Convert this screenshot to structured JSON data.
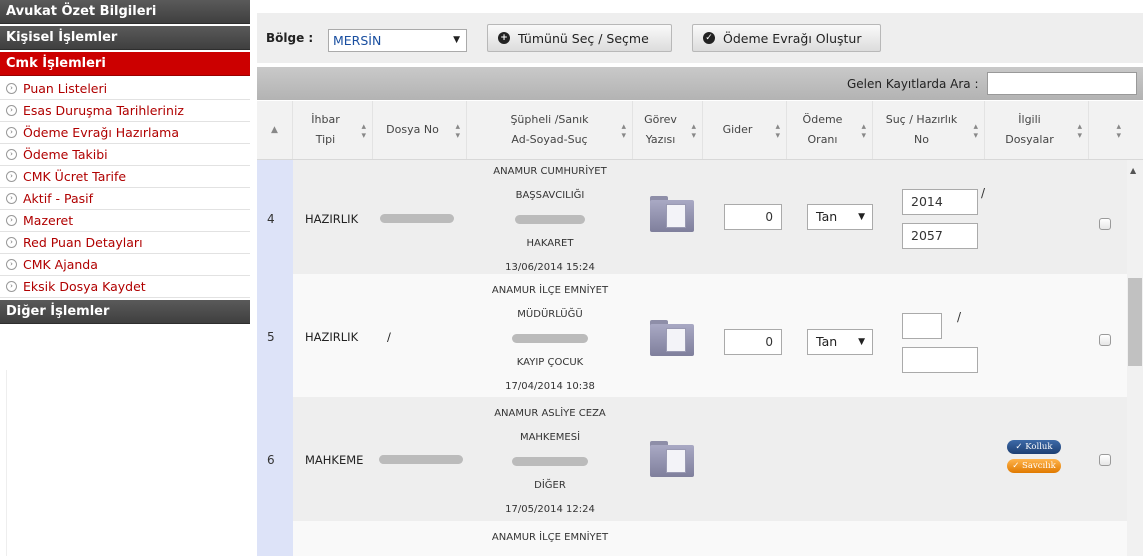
{
  "sidebar": {
    "sections": [
      {
        "label": "Avukat Özet Bilgileri"
      },
      {
        "label": "Kişisel İşlemler"
      },
      {
        "label": "Cmk İşlemleri"
      }
    ],
    "items": [
      {
        "label": "Puan Listeleri"
      },
      {
        "label": "Esas Duruşma Tarihleriniz"
      },
      {
        "label": "Ödeme Evrağı Hazırlama"
      },
      {
        "label": "Ödeme Takibi"
      },
      {
        "label": "CMK Ücret Tarife"
      },
      {
        "label": "Aktif - Pasif"
      },
      {
        "label": "Mazeret"
      },
      {
        "label": "Red Puan Detayları"
      },
      {
        "label": "CMK Ajanda"
      },
      {
        "label": "Eksik Dosya Kaydet"
      }
    ],
    "footer_section": "Diğer İşlemler",
    "item_icon": "arrow-circle-icon"
  },
  "toolbar": {
    "bolge_label": "Bölge :",
    "bolge_value": "MERSİN",
    "select_all_label": "Tümünü Seç / Seçme",
    "payment_doc_label": "Ödeme Evrağı Oluştur"
  },
  "search": {
    "label": "Gelen Kayıtlarda Ara :",
    "value": ""
  },
  "table": {
    "headers": {
      "ihbar_line1": "İhbar",
      "ihbar_line2": "Tipi",
      "dosya": "Dosya No",
      "supheli_line1": "Şüpheli /Sanık",
      "supheli_line2": "Ad-Soyad-Suç",
      "gorev_line1": "Görev",
      "gorev_line2": "Yazısı",
      "gider": "Gider",
      "odeme_line1": "Ödeme",
      "odeme_line2": "Oranı",
      "suc_line1": "Suç / Hazırlık",
      "suc_line2": "No",
      "ilgili_line1": "İlgili",
      "ilgili_line2": "Dosyalar"
    },
    "rows": [
      {
        "no": "4",
        "tip": "HAZIRLIK",
        "dosya_no": "",
        "kurum_line1": "ANAMUR CUMHURİYET",
        "kurum_line2": "BAŞSAVCILIĞI",
        "suc": "HAKARET",
        "tarih": "13/06/2014 15:24",
        "gider": "0",
        "odeme": "Tan",
        "suc_yil": "2014",
        "suc_no": "2057"
      },
      {
        "no": "5",
        "tip": "HAZIRLIK",
        "dosya_no": "/",
        "kurum_line1": "ANAMUR İLÇE EMNİYET",
        "kurum_line2": "MÜDÜRLÜĞÜ",
        "suc": "KAYIP ÇOCUK",
        "tarih": "17/04/2014 10:38",
        "gider": "0",
        "odeme": "Tan",
        "suc_yil": "",
        "suc_no": ""
      },
      {
        "no": "6",
        "tip": "MAHKEME",
        "dosya_no": "",
        "kurum_line1": "ANAMUR ASLİYE CEZA",
        "kurum_line2": "MAHKEMESİ",
        "suc": "DİĞER",
        "tarih": "17/05/2014 12:24",
        "badge_kolluk": "Kolluk",
        "badge_savcilik": "Savcılık"
      },
      {
        "kurum_line1": "ANAMUR İLÇE EMNİYET"
      }
    ]
  }
}
